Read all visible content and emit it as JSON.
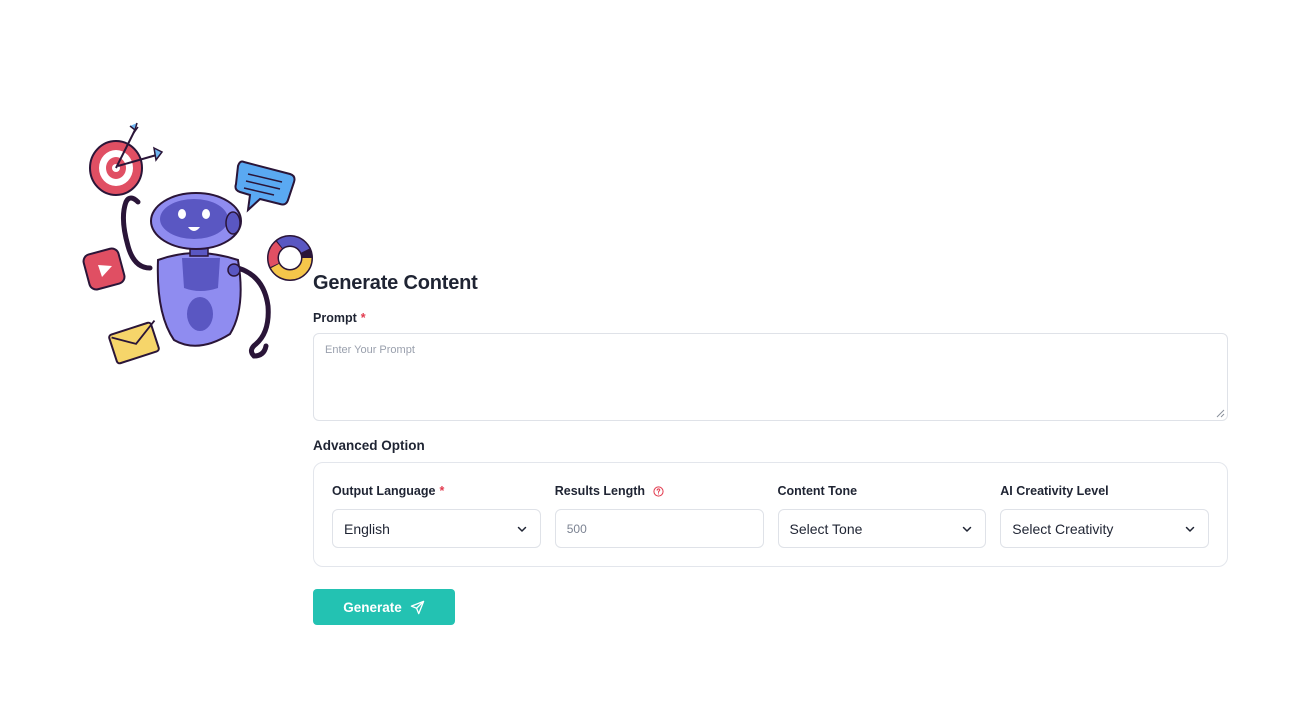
{
  "illustration": {
    "icon": "robot-illustration"
  },
  "form": {
    "title": "Generate Content",
    "prompt": {
      "label": "Prompt",
      "required_mark": "*",
      "placeholder": "Enter Your Prompt",
      "value": ""
    },
    "advanced": {
      "label": "Advanced Option",
      "fields": [
        {
          "label": "Output Language",
          "required_mark": "*",
          "value": "English",
          "icon": "chevron-down-icon"
        },
        {
          "label": "Results Length",
          "help_icon": "help-circle-icon",
          "value": "500"
        },
        {
          "label": "Content Tone",
          "value": "Select Tone",
          "icon": "chevron-down-icon"
        },
        {
          "label": "AI Creativity Level",
          "value": "Select Creativity",
          "icon": "chevron-down-icon"
        }
      ]
    },
    "generate_button": {
      "label": "Generate",
      "icon": "send-icon"
    }
  },
  "colors": {
    "accent": "#23c2b2",
    "required": "#e23a4e",
    "border": "#dfe2e8",
    "text": "#1f2433",
    "placeholder": "#9aa0ad"
  }
}
